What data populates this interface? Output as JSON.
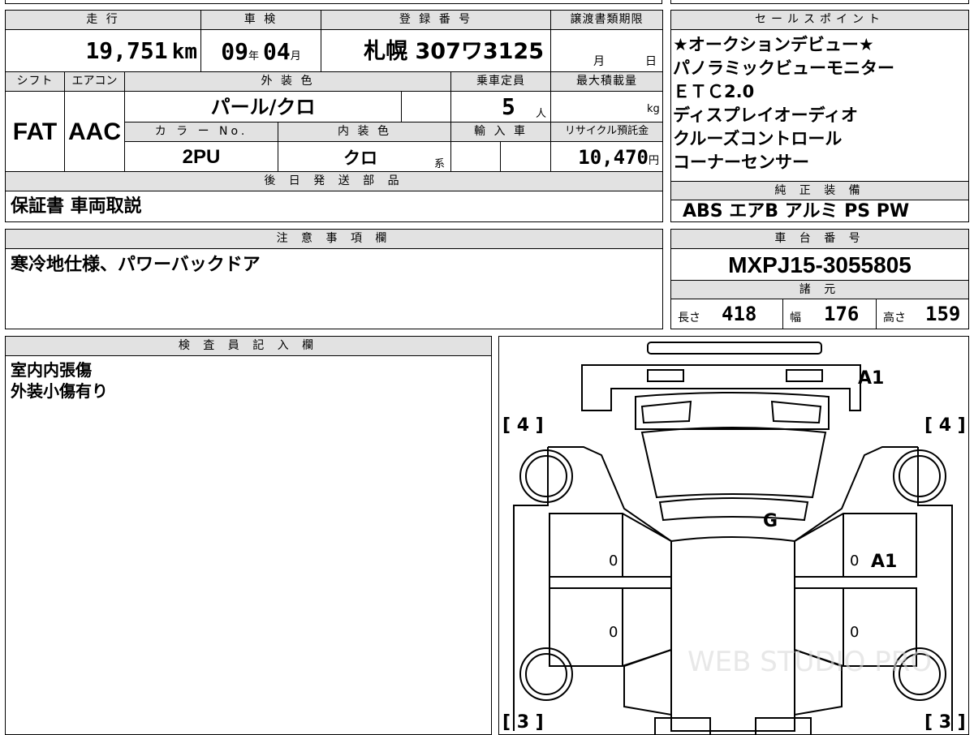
{
  "header": {
    "mileage_label": "走 行",
    "inspection_label": "車 検",
    "registration_label": "登 録 番 号",
    "transfer_deadline_label": "譲渡書類期限",
    "sales_points_label": "セールスポイント"
  },
  "values": {
    "mileage": "19,751",
    "mileage_unit": "km",
    "inspection_year": "09",
    "year_unit": "年",
    "inspection_month": "04",
    "month_unit": "月",
    "registration_number": "札幌 307ワ3125",
    "deadline_month_unit": "月",
    "deadline_day_unit": "日"
  },
  "row2": {
    "shift_label": "シフト",
    "aircon_label": "エアコン",
    "exterior_color_label": "外 装 色",
    "capacity_label": "乗車定員",
    "max_load_label": "最大積載量",
    "shift": "FAT",
    "aircon": "AAC",
    "exterior_color": "パール/クロ",
    "capacity": "5",
    "capacity_unit": "人",
    "load_unit": "kg",
    "color_no_label": "カ ラ ー No.",
    "interior_color_label": "内 装 色",
    "import_label": "輸 入 車",
    "recycle_label": "リサイクル預託金",
    "color_no": "2PU",
    "interior_color": "クロ",
    "interior_suffix": "系",
    "recycle_fee": "10,470",
    "recycle_unit": "円"
  },
  "sales_points": {
    "items": [
      "★オークションデビュー★",
      "パノラミックビューモニター",
      "ＥＴＣ2.0",
      "ディスプレイオーディオ",
      "クルーズコントロール",
      "コーナーセンサー"
    ]
  },
  "later_parts": {
    "label": "後 日 発 送 部 品",
    "value": "保証書 車両取説"
  },
  "genuine_equipment": {
    "label": "純 正 装 備",
    "value": "ABS エアB アルミ PS PW"
  },
  "notes": {
    "label": "注 意 事 項 欄",
    "value": "寒冷地仕様、パワーバックドア"
  },
  "chassis": {
    "label": "車 台 番 号",
    "value": "MXPJ15-3055805",
    "specs_label": "諸 元",
    "length_label": "長さ",
    "length": "418",
    "width_label": "幅",
    "width": "176",
    "height_label": "高さ",
    "height": "159"
  },
  "inspector": {
    "label": "検 査 員 記 入 欄",
    "lines": [
      "室内内張傷",
      "外装小傷有り"
    ]
  },
  "diagram": {
    "tire_front_left": "[ 4 ]",
    "tire_front_right": "[ 4 ]",
    "tire_rear_left": "[ 3 ]",
    "tire_rear_right": "[ 3 ]",
    "mark_front": "A1",
    "mark_windshield": "G",
    "mark_right_door": "A1",
    "door_marks": [
      "0",
      "0",
      "0",
      "0"
    ],
    "watermark": "WEB STUDIO PRO"
  }
}
